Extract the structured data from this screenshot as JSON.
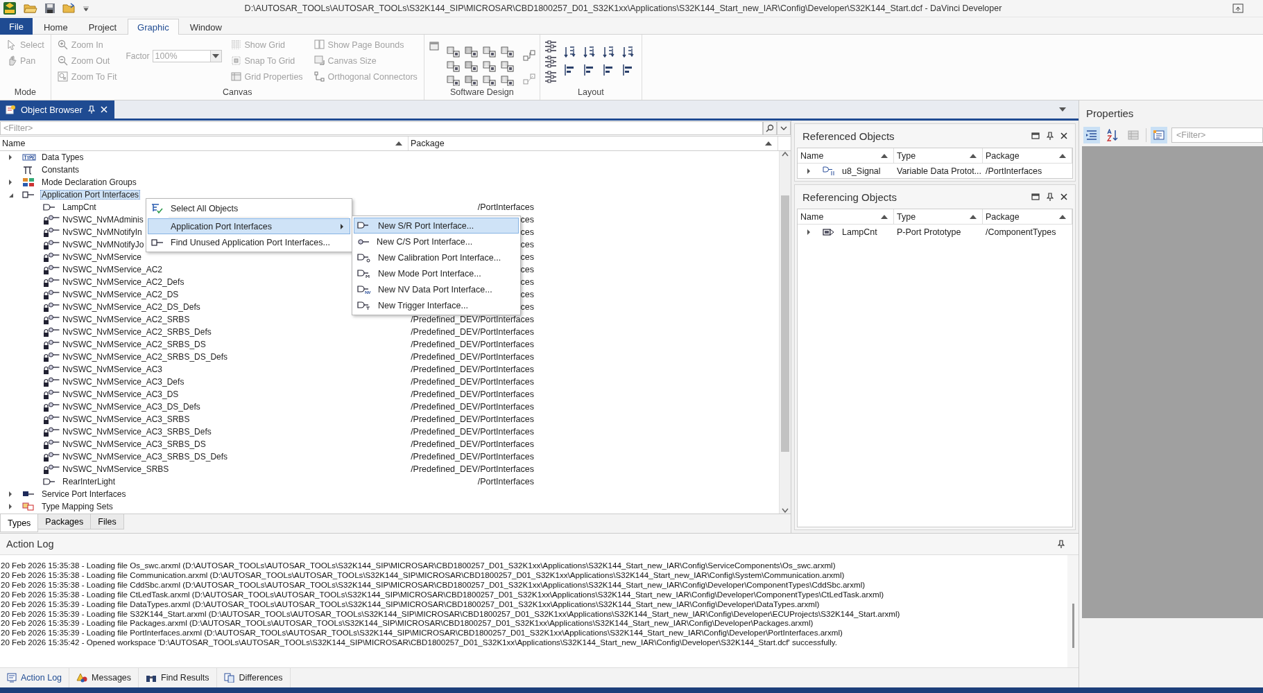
{
  "window": {
    "title": "D:\\AUTOSAR_TOOLs\\AUTOSAR_TOOLs\\S32K144_SIP\\MICROSAR\\CBD1800257_D01_S32K1xx\\Applications\\S32K144_Start_new_IAR\\Config\\Developer\\S32K144_Start.dcf - DaVinci Developer"
  },
  "ribbon": {
    "tabs": [
      {
        "label": "File",
        "kind": "file",
        "selected": false
      },
      {
        "label": "Home",
        "kind": "tab",
        "selected": false
      },
      {
        "label": "Project",
        "kind": "tab",
        "selected": false
      },
      {
        "label": "Graphic",
        "kind": "tab",
        "selected": true
      },
      {
        "label": "Window",
        "kind": "tab",
        "selected": false
      }
    ],
    "groups": [
      {
        "title": "Mode",
        "columns": [
          [
            {
              "kind": "button",
              "label": "Select",
              "disabled": true
            },
            {
              "kind": "button",
              "label": "Pan",
              "disabled": true
            }
          ]
        ]
      },
      {
        "title": "Canvas",
        "columns": [
          [
            {
              "kind": "button",
              "label": "Zoom In",
              "disabled": true
            },
            {
              "kind": "button",
              "label": "Zoom Out",
              "disabled": true
            },
            {
              "kind": "button",
              "label": "Zoom To Fit",
              "disabled": true
            }
          ],
          [
            {
              "kind": "combo",
              "label": "Factor",
              "value": "100%",
              "disabled": true
            }
          ],
          [
            {
              "kind": "button",
              "label": "Show Grid",
              "disabled": true
            },
            {
              "kind": "button",
              "label": "Snap To Grid",
              "disabled": true
            },
            {
              "kind": "button",
              "label": "Grid Properties",
              "disabled": true
            }
          ],
          [
            {
              "kind": "button",
              "label": "Show Page Bounds",
              "disabled": true
            },
            {
              "kind": "button",
              "label": "Canvas Size",
              "disabled": true
            },
            {
              "kind": "button",
              "label": "Orthogonal Connectors",
              "disabled": true
            }
          ]
        ]
      },
      {
        "title": "Software Design",
        "kind": "design-icons"
      },
      {
        "title": "Layout",
        "kind": "layout-icons"
      }
    ]
  },
  "object_browser": {
    "tab": {
      "label": "Object Browser"
    },
    "filter": {
      "placeholder": "<Filter>"
    },
    "columns": [
      "Name",
      "Package"
    ],
    "tree": [
      {
        "name": "Data Types",
        "kind": "types",
        "expanded": false,
        "selected": false
      },
      {
        "name": "Constants",
        "kind": "constants",
        "selected": false
      },
      {
        "name": "Mode Declaration Groups",
        "kind": "modes",
        "expanded": false,
        "selected": false
      },
      {
        "name": "Application Port Interfaces",
        "kind": "app-ports",
        "expanded": true,
        "selected": true,
        "children": [
          {
            "name": "LampCnt",
            "kind": "sr",
            "package": "/PortInterfaces",
            "selected": false
          },
          {
            "name": "NvSWC_NvMAdminis",
            "kind": "locked",
            "package": "ces",
            "selected": false
          },
          {
            "name": "NvSWC_NvMNotifyIn",
            "kind": "locked",
            "package": "ces",
            "selected": false
          },
          {
            "name": "NvSWC_NvMNotifyJo",
            "kind": "locked",
            "package": "ces",
            "selected": false
          },
          {
            "name": "NvSWC_NvMService",
            "kind": "locked",
            "package": "ces",
            "selected": false
          },
          {
            "name": "NvSWC_NvMService_AC2",
            "kind": "locked",
            "package": "ces",
            "selected": false
          },
          {
            "name": "NvSWC_NvMService_AC2_Defs",
            "kind": "locked",
            "package": "ces",
            "selected": false
          },
          {
            "name": "NvSWC_NvMService_AC2_DS",
            "kind": "locked",
            "package": "ces",
            "selected": false
          },
          {
            "name": "NvSWC_NvMService_AC2_DS_Defs",
            "kind": "locked",
            "package": "ces",
            "selected": false
          },
          {
            "name": "NvSWC_NvMService_AC2_SRBS",
            "kind": "locked",
            "package": "/Predefined_DEV/PortInterfaces",
            "selected": false
          },
          {
            "name": "NvSWC_NvMService_AC2_SRBS_Defs",
            "kind": "locked",
            "package": "/Predefined_DEV/PortInterfaces",
            "selected": false
          },
          {
            "name": "NvSWC_NvMService_AC2_SRBS_DS",
            "kind": "locked",
            "package": "/Predefined_DEV/PortInterfaces",
            "selected": false
          },
          {
            "name": "NvSWC_NvMService_AC2_SRBS_DS_Defs",
            "kind": "locked",
            "package": "/Predefined_DEV/PortInterfaces",
            "selected": false
          },
          {
            "name": "NvSWC_NvMService_AC3",
            "kind": "locked",
            "package": "/Predefined_DEV/PortInterfaces",
            "selected": false
          },
          {
            "name": "NvSWC_NvMService_AC3_Defs",
            "kind": "locked",
            "package": "/Predefined_DEV/PortInterfaces",
            "selected": false
          },
          {
            "name": "NvSWC_NvMService_AC3_DS",
            "kind": "locked",
            "package": "/Predefined_DEV/PortInterfaces",
            "selected": false
          },
          {
            "name": "NvSWC_NvMService_AC3_DS_Defs",
            "kind": "locked",
            "package": "/Predefined_DEV/PortInterfaces",
            "selected": false
          },
          {
            "name": "NvSWC_NvMService_AC3_SRBS",
            "kind": "locked",
            "package": "/Predefined_DEV/PortInterfaces",
            "selected": false
          },
          {
            "name": "NvSWC_NvMService_AC3_SRBS_Defs",
            "kind": "locked",
            "package": "/Predefined_DEV/PortInterfaces",
            "selected": false
          },
          {
            "name": "NvSWC_NvMService_AC3_SRBS_DS",
            "kind": "locked",
            "package": "/Predefined_DEV/PortInterfaces",
            "selected": false
          },
          {
            "name": "NvSWC_NvMService_AC3_SRBS_DS_Defs",
            "kind": "locked",
            "package": "/Predefined_DEV/PortInterfaces",
            "selected": false
          },
          {
            "name": "NvSWC_NvMService_SRBS",
            "kind": "locked",
            "package": "/Predefined_DEV/PortInterfaces",
            "selected": false
          },
          {
            "name": "RearInterLight",
            "kind": "sr",
            "package": "/PortInterfaces",
            "selected": false
          }
        ]
      },
      {
        "name": "Service Port Interfaces",
        "kind": "service",
        "expanded": false,
        "selected": false
      },
      {
        "name": "Type Mapping Sets",
        "kind": "mapping",
        "expanded": false,
        "selected": false
      }
    ],
    "context_menu": {
      "items": [
        {
          "label": "Select All Objects",
          "kind": "select-all",
          "selected": false
        },
        {
          "label": "Application Port Interfaces",
          "kind": "submenu",
          "selected": true
        },
        {
          "label": "Find Unused Application Port Interfaces...",
          "kind": "find",
          "selected": false
        }
      ],
      "submenu": [
        {
          "label": "New S/R Port Interface...",
          "kind": "sr",
          "selected": true
        },
        {
          "label": "New C/S Port Interface...",
          "kind": "cs",
          "selected": false
        },
        {
          "label": "New Calibration Port Interface...",
          "kind": "cal",
          "selected": false
        },
        {
          "label": "New Mode Port Interface...",
          "kind": "mode",
          "selected": false
        },
        {
          "label": "New NV Data Port Interface...",
          "kind": "nv",
          "selected": false
        },
        {
          "label": "New Trigger Interface...",
          "kind": "trigger",
          "selected": false
        }
      ]
    },
    "bottom_tabs": [
      {
        "label": "Types",
        "selected": true
      },
      {
        "label": "Packages",
        "selected": false
      },
      {
        "label": "Files",
        "selected": false
      }
    ]
  },
  "referenced_objects": {
    "title": "Referenced Objects",
    "columns": [
      "Name",
      "Type",
      "Package"
    ],
    "rows": [
      {
        "name": "u8_Signal",
        "kind": "data",
        "type": "Variable Data Protot...",
        "package": "/PortInterfaces",
        "expanded": false
      }
    ]
  },
  "referencing_objects": {
    "title": "Referencing Objects",
    "columns": [
      "Name",
      "Type",
      "Package"
    ],
    "rows": [
      {
        "name": "LampCnt",
        "kind": "port",
        "type": "P-Port Prototype",
        "package": "/ComponentTypes",
        "expanded": false
      }
    ]
  },
  "properties": {
    "title": "Properties",
    "filter": {
      "placeholder": "<Filter>"
    }
  },
  "action_log": {
    "title": "Action Log",
    "lines": [
      "20 Feb 2026 15:35:38 - Loading file Os_swc.arxml (D:\\AUTOSAR_TOOLs\\AUTOSAR_TOOLs\\S32K144_SIP\\MICROSAR\\CBD1800257_D01_S32K1xx\\Applications\\S32K144_Start_new_IAR\\Config\\ServiceComponents\\Os_swc.arxml)",
      "20 Feb 2026 15:35:38 - Loading file Communication.arxml (D:\\AUTOSAR_TOOLs\\AUTOSAR_TOOLs\\S32K144_SIP\\MICROSAR\\CBD1800257_D01_S32K1xx\\Applications\\S32K144_Start_new_IAR\\Config\\System\\Communication.arxml)",
      "20 Feb 2026 15:35:38 - Loading file CddSbc.arxml (D:\\AUTOSAR_TOOLs\\AUTOSAR_TOOLs\\S32K144_SIP\\MICROSAR\\CBD1800257_D01_S32K1xx\\Applications\\S32K144_Start_new_IAR\\Config\\Developer\\ComponentTypes\\CddSbc.arxml)",
      "20 Feb 2026 15:35:38 - Loading file CtLedTask.arxml (D:\\AUTOSAR_TOOLs\\AUTOSAR_TOOLs\\S32K144_SIP\\MICROSAR\\CBD1800257_D01_S32K1xx\\Applications\\S32K144_Start_new_IAR\\Config\\Developer\\ComponentTypes\\CtLedTask.arxml)",
      "20 Feb 2026 15:35:39 - Loading file DataTypes.arxml (D:\\AUTOSAR_TOOLs\\AUTOSAR_TOOLs\\S32K144_SIP\\MICROSAR\\CBD1800257_D01_S32K1xx\\Applications\\S32K144_Start_new_IAR\\Config\\Developer\\DataTypes.arxml)",
      "20 Feb 2026 15:35:39 - Loading file S32K144_Start.arxml (D:\\AUTOSAR_TOOLs\\AUTOSAR_TOOLs\\S32K144_SIP\\MICROSAR\\CBD1800257_D01_S32K1xx\\Applications\\S32K144_Start_new_IAR\\Config\\Developer\\ECUProjects\\S32K144_Start.arxml)",
      "20 Feb 2026 15:35:39 - Loading file Packages.arxml (D:\\AUTOSAR_TOOLs\\AUTOSAR_TOOLs\\S32K144_SIP\\MICROSAR\\CBD1800257_D01_S32K1xx\\Applications\\S32K144_Start_new_IAR\\Config\\Developer\\Packages.arxml)",
      "20 Feb 2026 15:35:39 - Loading file PortInterfaces.arxml (D:\\AUTOSAR_TOOLs\\AUTOSAR_TOOLs\\S32K144_SIP\\MICROSAR\\CBD1800257_D01_S32K1xx\\Applications\\S32K144_Start_new_IAR\\Config\\Developer\\PortInterfaces.arxml)",
      "20 Feb 2026 15:35:42 - Opened workspace 'D:\\AUTOSAR_TOOLs\\AUTOSAR_TOOLs\\S32K144_SIP\\MICROSAR\\CBD1800257_D01_S32K1xx\\Applications\\S32K144_Start_new_IAR\\Config\\Developer\\S32K144_Start.dcf' successfully."
    ],
    "tabs": [
      {
        "label": "Action Log",
        "kind": "log",
        "selected": true
      },
      {
        "label": "Messages",
        "kind": "messages",
        "selected": false
      },
      {
        "label": "Find Results",
        "kind": "find",
        "selected": false
      },
      {
        "label": "Differences",
        "kind": "diff",
        "selected": false
      }
    ]
  }
}
